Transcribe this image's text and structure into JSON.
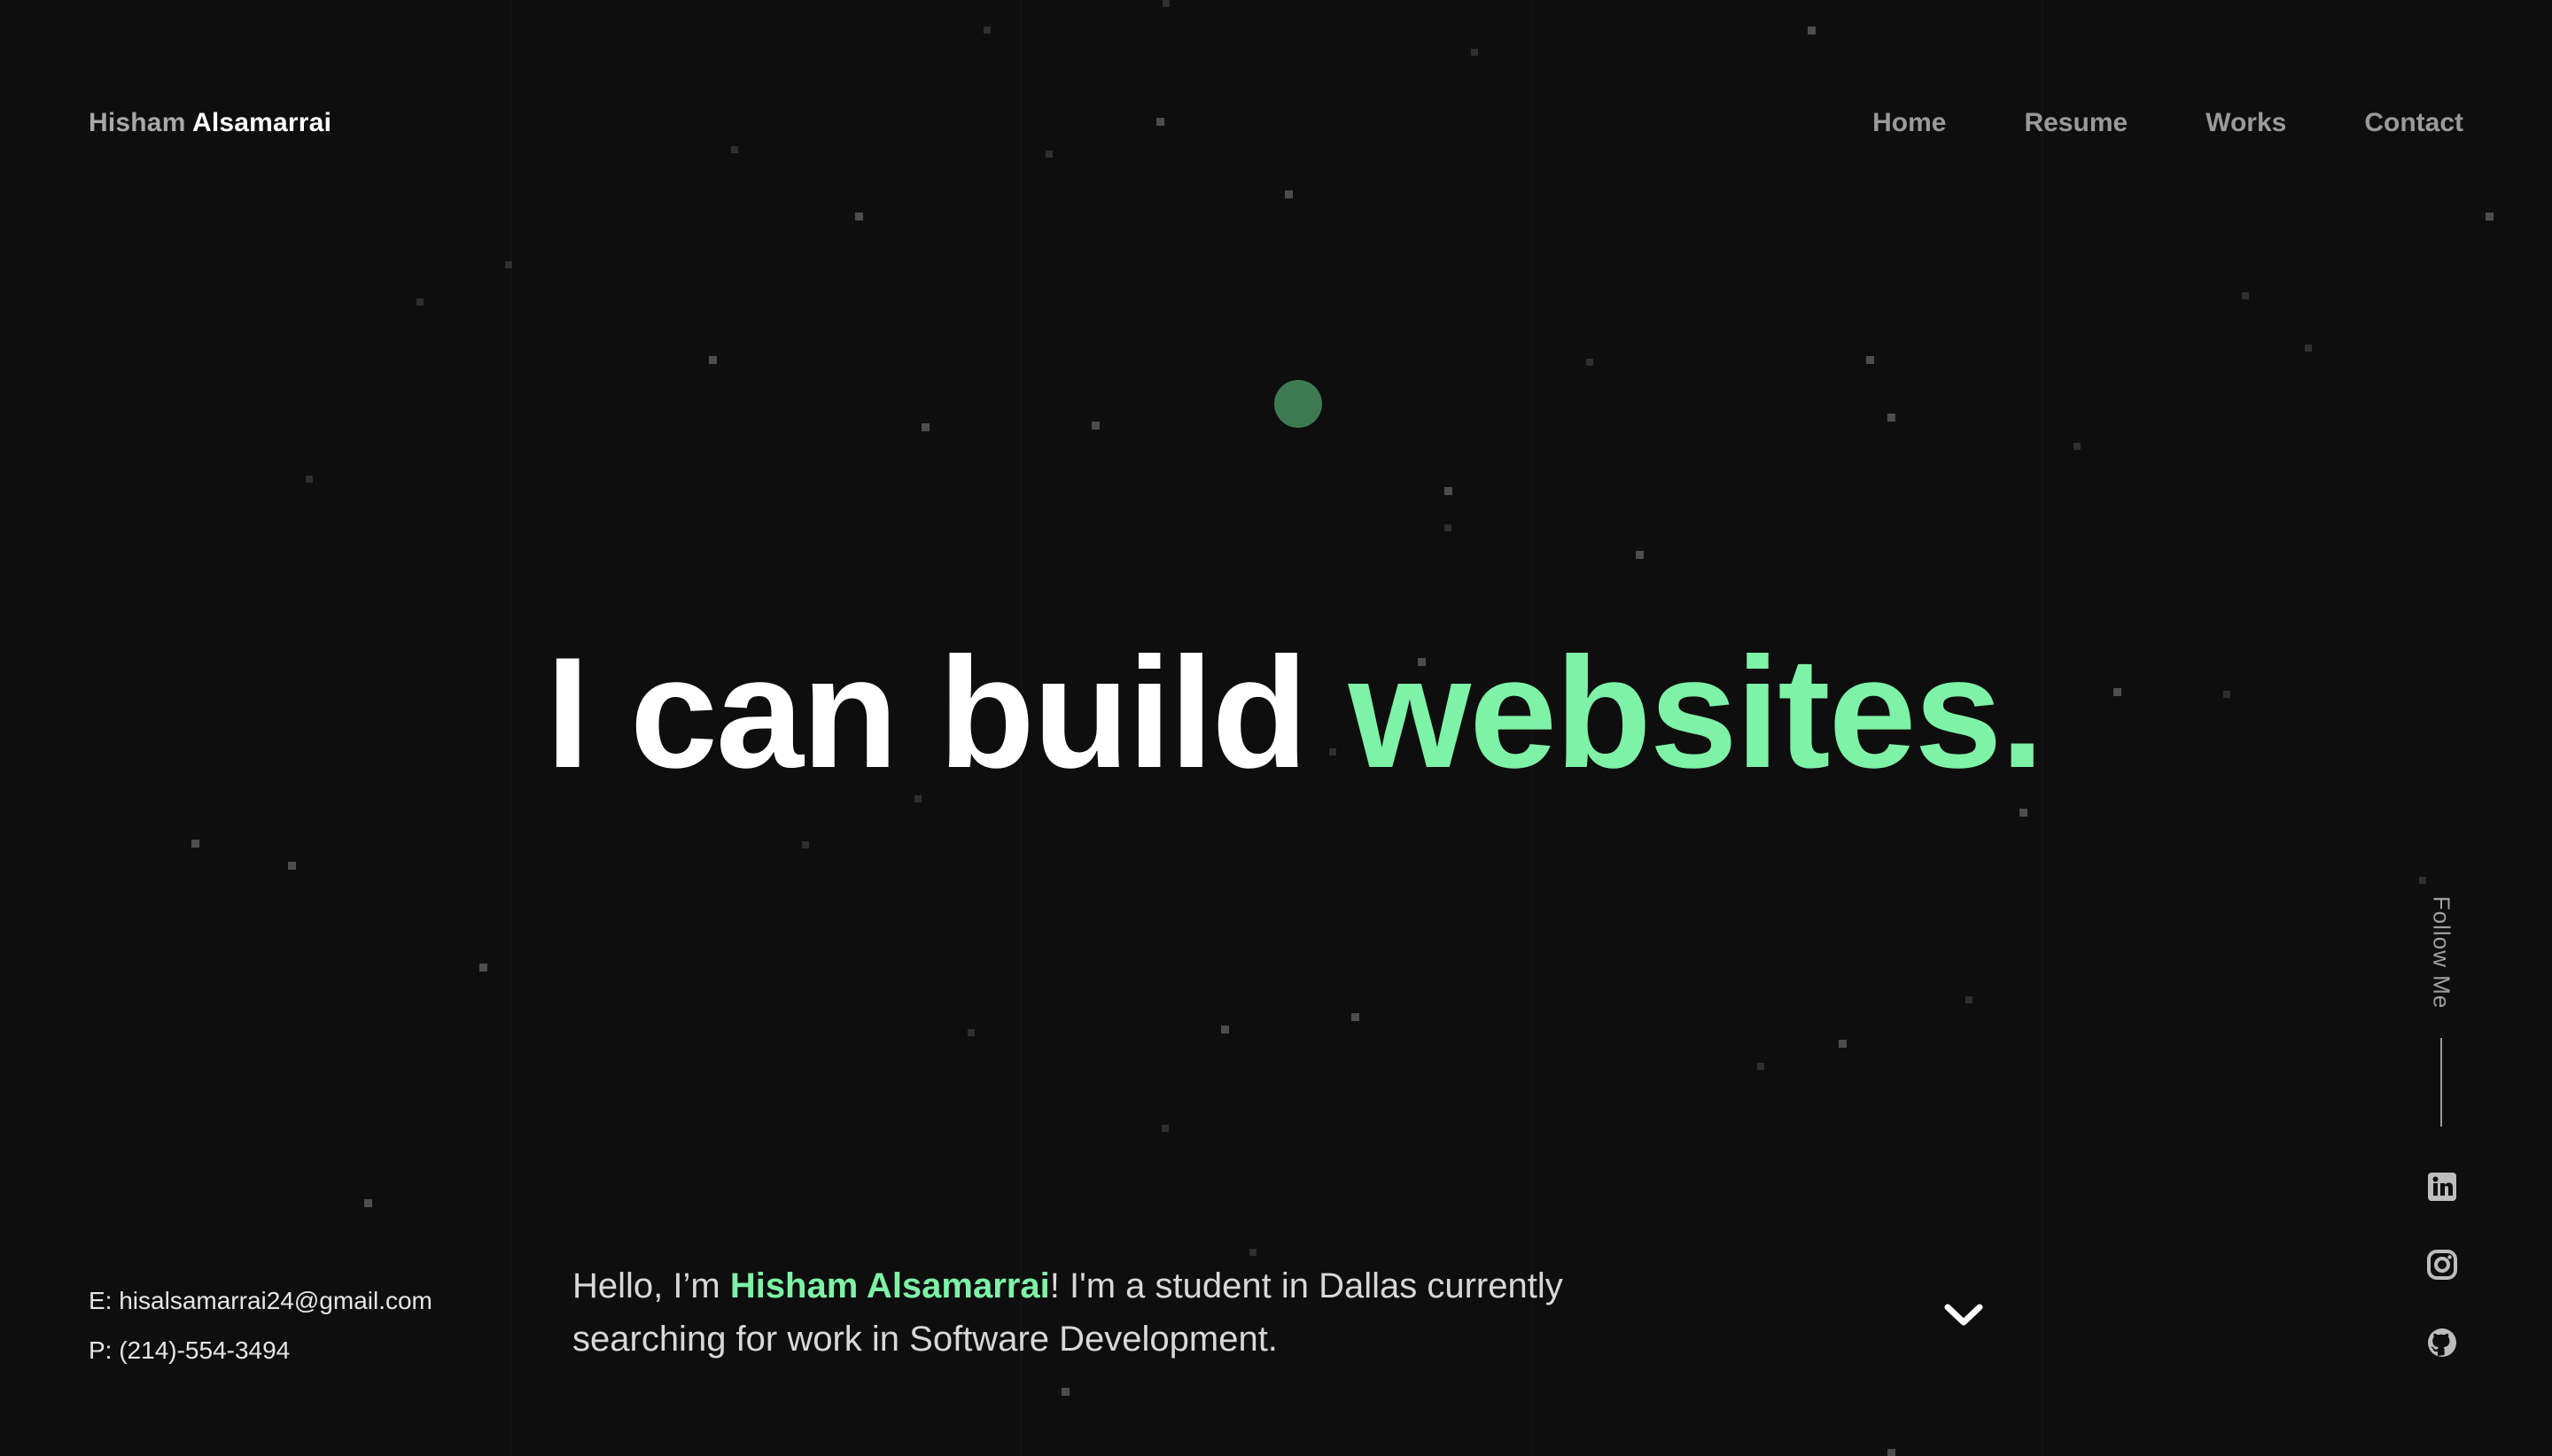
{
  "header": {
    "brand_first": "Hisham",
    "brand_last": "Alsamarrai",
    "nav": [
      "Home",
      "Resume",
      "Works",
      "Contact"
    ]
  },
  "hero": {
    "headline_plain": "I can build ",
    "headline_accent": "websites."
  },
  "contact": {
    "email": "E: hisalsamarrai24@gmail.com",
    "phone": "P: (214)-554-3494"
  },
  "intro": {
    "before": "Hello, I’m ",
    "name": "Hisham Alsamarrai",
    "after": "! I'm a student in Dallas currently searching for work in Software Development."
  },
  "follow": {
    "label": "Follow Me",
    "icons": [
      "linkedin-icon",
      "instagram-icon",
      "github-icon"
    ]
  },
  "colors": {
    "background": "#0e0e0e",
    "accent": "#7ef2a6",
    "dot": "#3e7a51"
  }
}
